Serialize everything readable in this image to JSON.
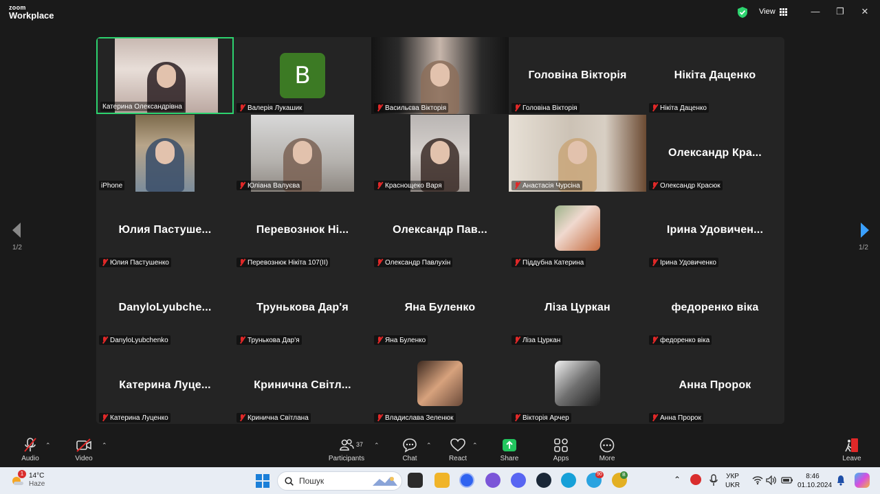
{
  "app": {
    "logo_top": "zoom",
    "logo_bottom": "Workplace",
    "view_label": "View"
  },
  "grid": [
    {
      "label": "Катерина Олександрівна",
      "big": "",
      "type": "video",
      "active": true,
      "muted": false
    },
    {
      "label": "Валерія Лукашик",
      "big": "",
      "type": "avatar",
      "avatar_letter": "B",
      "muted": true
    },
    {
      "label": "Васильєва Вікторія",
      "big": "",
      "type": "video",
      "muted": true
    },
    {
      "label": "Головіна Вікторія",
      "big": "Головіна Вікторія",
      "type": "name",
      "muted": true
    },
    {
      "label": "Нікіта Даценко",
      "big": "Нікіта Даценко",
      "type": "name",
      "muted": true
    },
    {
      "label": "iPhone",
      "big": "",
      "type": "video",
      "muted": false
    },
    {
      "label": "Юліана Валуєва",
      "big": "",
      "type": "video",
      "muted": true
    },
    {
      "label": "Краснощеко Варя",
      "big": "",
      "type": "video",
      "muted": true
    },
    {
      "label": "Анастасія Чурсіна",
      "big": "",
      "type": "video",
      "muted": true
    },
    {
      "label": "Олександр Красюк",
      "big": "Олександр Кра...",
      "type": "name",
      "muted": true
    },
    {
      "label": "Юлия Пастушенко",
      "big": "Юлия Пастуше...",
      "type": "name",
      "muted": true
    },
    {
      "label": "Перевознюк Нікіта 107(ІІ)",
      "big": "Перевознюк Ні...",
      "type": "name",
      "muted": true
    },
    {
      "label": "Олександр Павлухін",
      "big": "Олександр Пав...",
      "type": "name",
      "muted": true
    },
    {
      "label": "Піддубна Катерина",
      "big": "",
      "type": "photo",
      "muted": true
    },
    {
      "label": "Ірина Удовиченко",
      "big": "Ірина Удовичен...",
      "type": "name",
      "muted": true
    },
    {
      "label": "DanyloLyubchenko",
      "big": "DanyloLyubche...",
      "type": "name",
      "muted": true
    },
    {
      "label": "Трунькова Дар'я",
      "big": "Трунькова Дар'я",
      "type": "name",
      "muted": true
    },
    {
      "label": "Яна Буленко",
      "big": "Яна Буленко",
      "type": "name",
      "muted": true
    },
    {
      "label": "Ліза Цуркан",
      "big": "Ліза Цуркан",
      "type": "name",
      "muted": true
    },
    {
      "label": "федоренко віка",
      "big": "федоренко віка",
      "type": "name",
      "muted": true
    },
    {
      "label": "Катерина Луценко",
      "big": "Катерина Луце...",
      "type": "name",
      "muted": true
    },
    {
      "label": "Кринична Світлана",
      "big": "Кринична Світл...",
      "type": "name",
      "muted": true
    },
    {
      "label": "Владислава Зеленюк",
      "big": "",
      "type": "photo",
      "muted": true
    },
    {
      "label": "Вікторія Арчер",
      "big": "",
      "type": "photo",
      "muted": true
    },
    {
      "label": "Анна Пророк",
      "big": "Анна Пророк",
      "type": "name",
      "muted": true
    }
  ],
  "paging": {
    "left": "1/2",
    "right": "1/2"
  },
  "toolbar": {
    "audio": "Audio",
    "video": "Video",
    "participants": "Participants",
    "participant_count": "37",
    "chat": "Chat",
    "react": "React",
    "share": "Share",
    "apps": "Apps",
    "more": "More",
    "leave": "Leave"
  },
  "taskbar": {
    "weather_temp": "14°C",
    "weather_desc": "Haze",
    "weather_badge": "1",
    "search_placeholder": "Пошук",
    "lang_top": "УКР",
    "lang_bottom": "UKR",
    "time": "8:46",
    "date": "01.10.2024",
    "telegram_badge": "90",
    "chrome_badge": "B"
  },
  "colors": {
    "active_border": "#2dd36f",
    "mute_red": "#e02828",
    "share_green": "#22c55e",
    "leave_red": "#e02828"
  }
}
